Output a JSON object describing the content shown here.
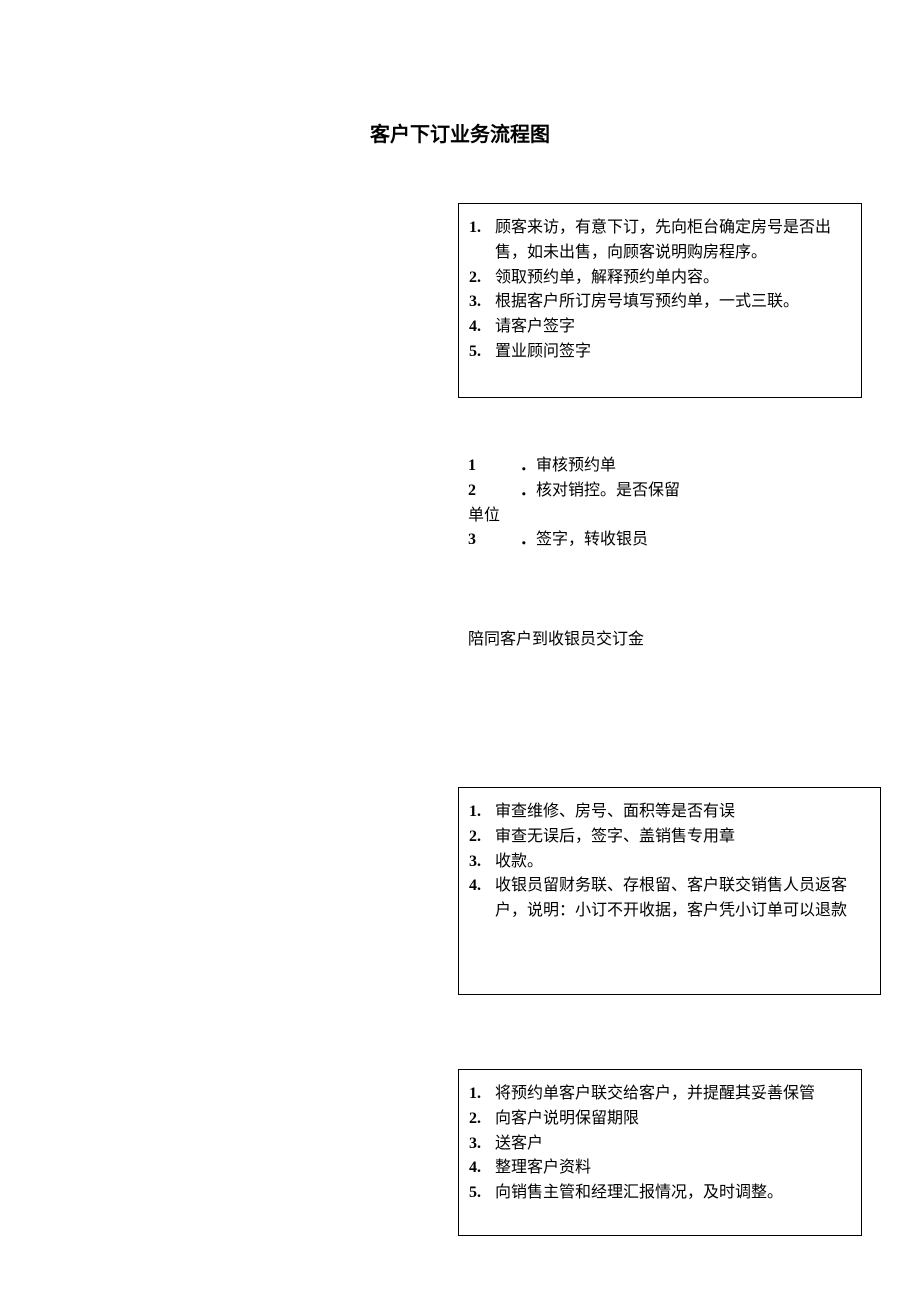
{
  "title": "客户下订业务流程图",
  "box1": {
    "items": [
      "顾客来访，有意下订，先向柜台确定房号是否出售，如未出售，向顾客说明购房程序。",
      "领取预约单，解释预约单内容。",
      "根据客户所订房号填写预约单，一式三联。",
      "请客户签字",
      "置业顾问签字"
    ]
  },
  "list2": {
    "items": [
      "审核预约单",
      "核对销控。是否保留单位",
      "签字，转收银员"
    ],
    "wrapped_part": "单位"
  },
  "escort_text": "陪同客户到收银员交订金",
  "box3": {
    "items": [
      "审查维修、房号、面积等是否有误",
      "审查无误后，签字、盖销售专用章",
      "收款。",
      "收银员留财务联、存根留、客户联交销售人员返客户，说明：小订不开收据，客户凭小订单可以退款"
    ]
  },
  "box4": {
    "items": [
      "将预约单客户联交给客户，并提醒其妥善保管",
      "向客户说明保留期限",
      "送客户",
      "整理客户资料",
      "向销售主管和经理汇报情况，及时调整。"
    ]
  }
}
